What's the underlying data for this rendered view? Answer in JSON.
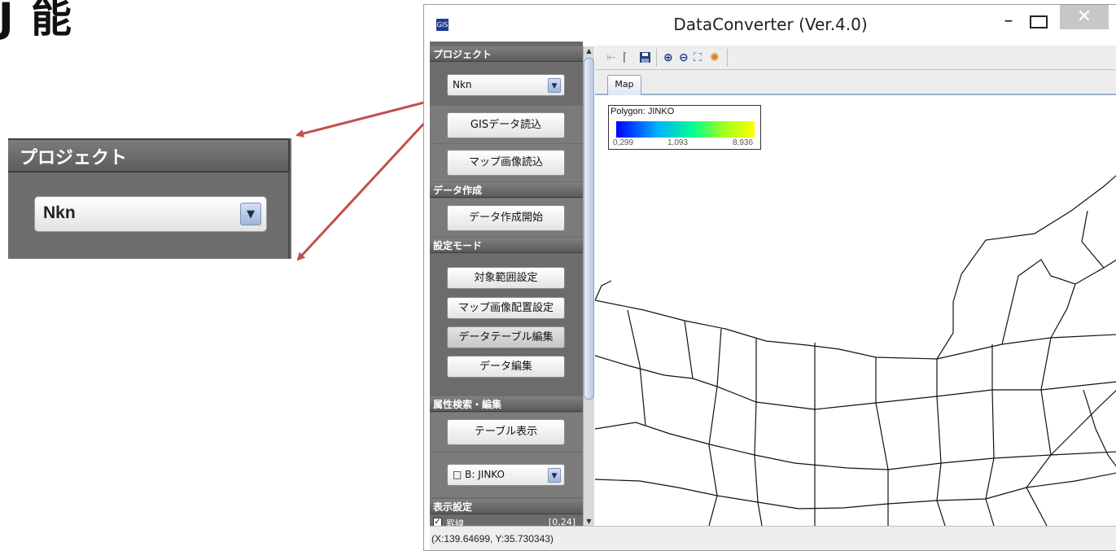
{
  "slide": {
    "heading": "J 能"
  },
  "callout": {
    "header": "プロジェクト",
    "value": "Nkn"
  },
  "window": {
    "title": "DataConverter (Ver.4.0)",
    "app_icon": "GIS",
    "controls": {
      "minimize": "minimize-icon",
      "maximize": "maximize-icon",
      "close": "close-icon"
    }
  },
  "panel": {
    "project": {
      "header": "プロジェクト",
      "value": "Nkn",
      "buttons": [
        "GISデータ読込",
        "マップ画像読込"
      ]
    },
    "data_create": {
      "header": "データ作成",
      "button": "データ作成開始"
    },
    "settings": {
      "header": "設定モード",
      "buttons": [
        "対象範囲設定",
        "マップ画像配置設定",
        "データテーブル編集",
        "データ編集"
      ]
    },
    "attribute": {
      "header": "属性検索・編集",
      "button": "テーブル表示",
      "layer_value": "□ B: JINKO"
    },
    "display": {
      "header": "表示設定",
      "row_label": "罫線",
      "row_range": "[0,24]"
    }
  },
  "toolbar": {
    "icons": [
      "back-icon",
      "select-icon",
      "save-icon",
      "zoom-in-icon",
      "zoom-out-icon",
      "fit-extent-icon",
      "refresh-icon"
    ]
  },
  "tabs": [
    "Map"
  ],
  "legend": {
    "title": "Polygon: JINKO",
    "ticks": [
      "0,299",
      "1,093",
      "8,936"
    ]
  },
  "status": {
    "coords": "(X:139.64699, Y:35.730343)"
  },
  "colors": {
    "arrow": "#c0504d",
    "panel_bg": "#6c6c6c",
    "legend_low": "#0000ff",
    "legend_high": "#ffff00"
  }
}
